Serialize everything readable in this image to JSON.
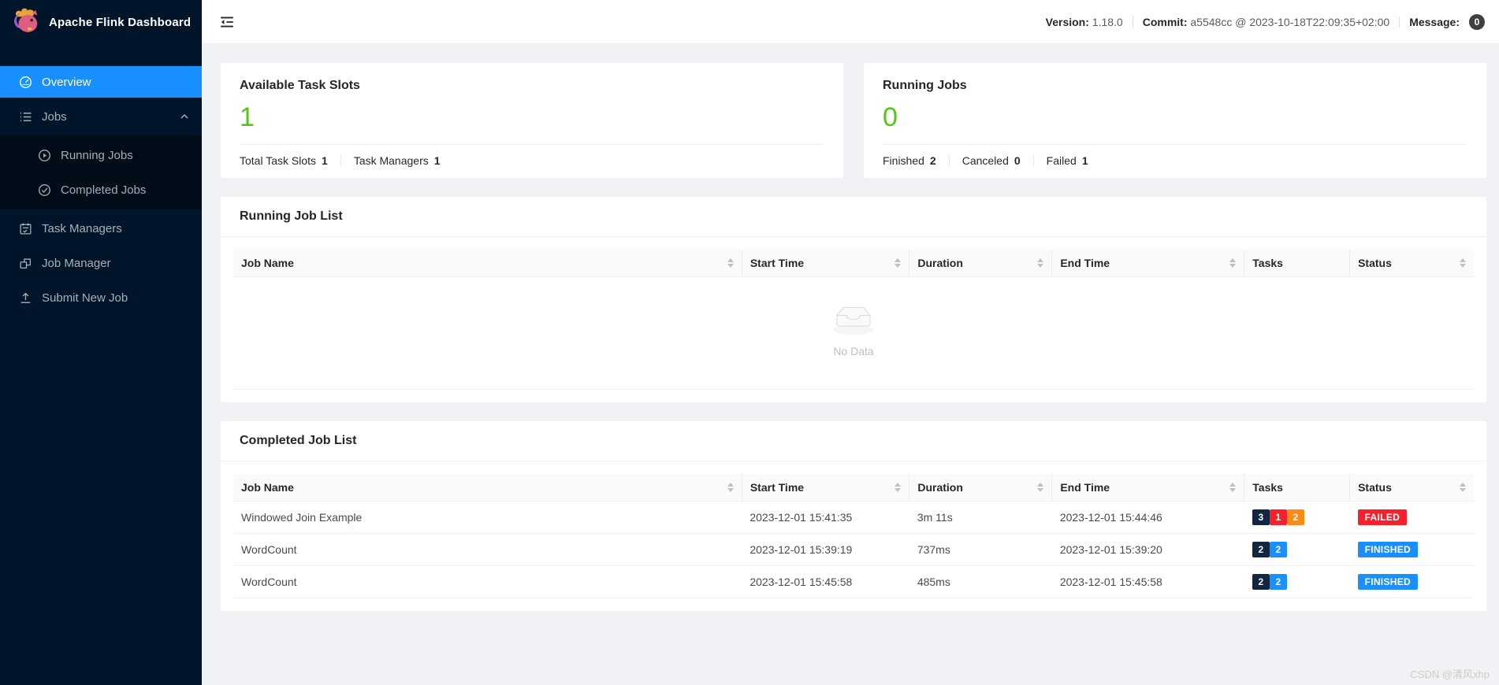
{
  "app": {
    "title": "Apache Flink Dashboard"
  },
  "header": {
    "version_label": "Version:",
    "version": "1.18.0",
    "commit_label": "Commit:",
    "commit": "a5548cc @ 2023-10-18T22:09:35+02:00",
    "message_label": "Message:",
    "message_count": "0"
  },
  "sidebar": {
    "items": [
      {
        "label": "Overview",
        "icon": "dashboard-icon",
        "active": true
      },
      {
        "label": "Jobs",
        "icon": "list-icon",
        "expanded": true
      },
      {
        "label": "Running Jobs",
        "icon": "play-circle-icon"
      },
      {
        "label": "Completed Jobs",
        "icon": "check-circle-icon"
      },
      {
        "label": "Task Managers",
        "icon": "schedule-icon"
      },
      {
        "label": "Job Manager",
        "icon": "deployment-icon"
      },
      {
        "label": "Submit New Job",
        "icon": "upload-icon"
      }
    ]
  },
  "stats": [
    {
      "title": "Available Task Slots",
      "value": "1",
      "footer": [
        {
          "label": "Total Task Slots",
          "value": "1"
        },
        {
          "label": "Task Managers",
          "value": "1"
        }
      ]
    },
    {
      "title": "Running Jobs",
      "value": "0",
      "footer": [
        {
          "label": "Finished",
          "value": "2"
        },
        {
          "label": "Canceled",
          "value": "0"
        },
        {
          "label": "Failed",
          "value": "1"
        }
      ]
    }
  ],
  "running_jobs": {
    "title": "Running Job List",
    "columns": [
      {
        "label": "Job Name",
        "sortable": true
      },
      {
        "label": "Start Time",
        "sortable": true
      },
      {
        "label": "Duration",
        "sortable": true
      },
      {
        "label": "End Time",
        "sortable": true
      },
      {
        "label": "Tasks",
        "sortable": false
      },
      {
        "label": "Status",
        "sortable": true
      }
    ],
    "empty_text": "No Data"
  },
  "completed_jobs": {
    "title": "Completed Job List",
    "columns": [
      {
        "label": "Job Name",
        "sortable": true
      },
      {
        "label": "Start Time",
        "sortable": true
      },
      {
        "label": "Duration",
        "sortable": true
      },
      {
        "label": "End Time",
        "sortable": true
      },
      {
        "label": "Tasks",
        "sortable": false
      },
      {
        "label": "Status",
        "sortable": true
      }
    ],
    "rows": [
      {
        "job_name": "Windowed Join Example",
        "start_time": "2023-12-01 15:41:35",
        "duration": "3m 11s",
        "end_time": "2023-12-01 15:44:46",
        "tasks": [
          {
            "count": "3",
            "color": "#112641"
          },
          {
            "count": "1",
            "color": "#f5222d"
          },
          {
            "count": "2",
            "color": "#fa8c16"
          }
        ],
        "status": {
          "label": "FAILED",
          "color": "#f5222d"
        }
      },
      {
        "job_name": "WordCount",
        "start_time": "2023-12-01 15:39:19",
        "duration": "737ms",
        "end_time": "2023-12-01 15:39:20",
        "tasks": [
          {
            "count": "2",
            "color": "#112641"
          },
          {
            "count": "2",
            "color": "#1890ff"
          }
        ],
        "status": {
          "label": "FINISHED",
          "color": "#1890ff"
        }
      },
      {
        "job_name": "WordCount",
        "start_time": "2023-12-01 15:45:58",
        "duration": "485ms",
        "end_time": "2023-12-01 15:45:58",
        "tasks": [
          {
            "count": "2",
            "color": "#112641"
          },
          {
            "count": "2",
            "color": "#1890ff"
          }
        ],
        "status": {
          "label": "FINISHED",
          "color": "#1890ff"
        }
      }
    ]
  },
  "watermark": "CSDN @清风xhp",
  "colors": {
    "accent": "#1890ff",
    "success_green": "#52c41a",
    "failed_red": "#f5222d",
    "canceled_orange": "#fa8c16",
    "total_navy": "#112641",
    "sidebar_bg": "#001529",
    "submenu_bg": "#000c17"
  }
}
